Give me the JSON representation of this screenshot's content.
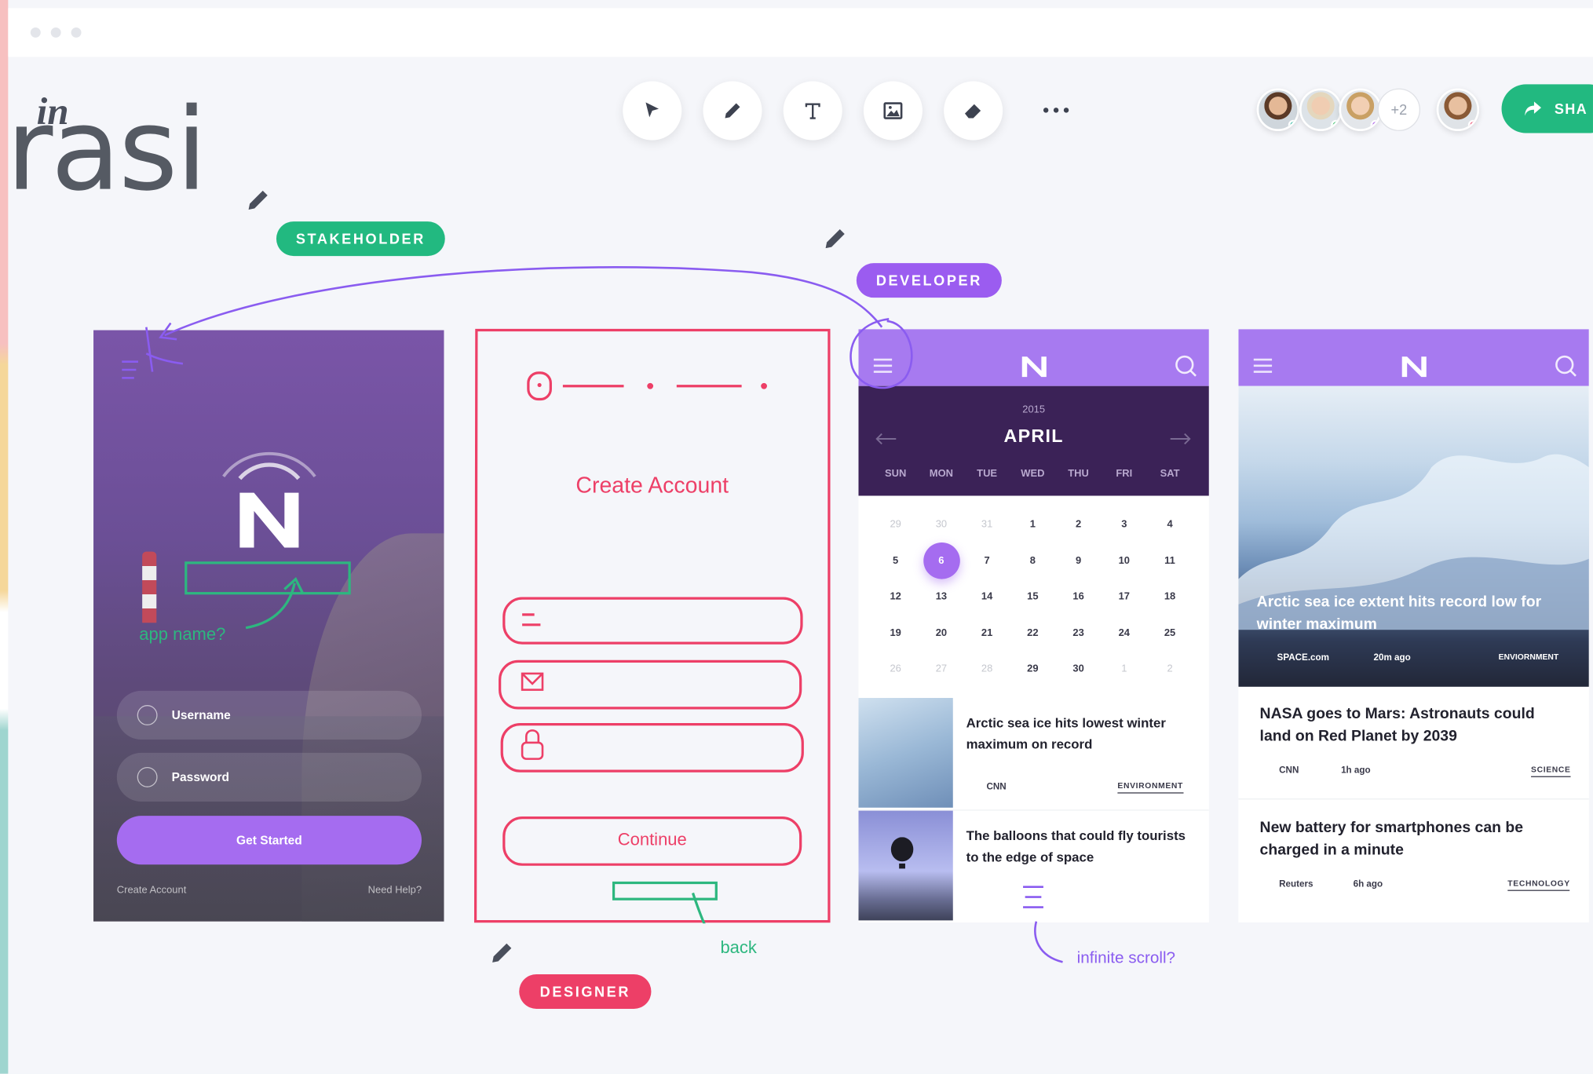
{
  "app": {
    "logo_in": "in",
    "logo_text": "rasi"
  },
  "toolbar": {
    "tools": [
      "pointer-tool",
      "pencil-tool",
      "text-tool",
      "image-tool",
      "eraser-tool",
      "more-tools"
    ],
    "collaborators_more": "+2",
    "share_label": "SHA"
  },
  "roles": {
    "stakeholder": "STAKEHOLDER",
    "developer": "DEVELOPER",
    "designer": "DESIGNER"
  },
  "colors": {
    "accent_purple": "#a56cf0",
    "green": "#22b980",
    "pink": "#ed3f67",
    "role_purple": "#9b5cf0"
  },
  "login": {
    "annotation": "app name?",
    "username": "Username",
    "password": "Password",
    "cta": "Get Started",
    "create_account": "Create Account",
    "need_help": "Need Help?"
  },
  "wireframe": {
    "title": "Create Account",
    "continue": "Continue",
    "annotation_back": "back"
  },
  "calendar": {
    "year": "2015",
    "month": "APRIL",
    "weekdays": [
      "SUN",
      "MON",
      "TUE",
      "WED",
      "THU",
      "FRI",
      "SAT"
    ],
    "weeks": [
      [
        "29",
        "30",
        "31",
        "1",
        "2",
        "3",
        "4"
      ],
      [
        "5",
        "6",
        "7",
        "8",
        "9",
        "10",
        "11"
      ],
      [
        "12",
        "13",
        "14",
        "15",
        "16",
        "17",
        "18"
      ],
      [
        "19",
        "20",
        "21",
        "22",
        "23",
        "24",
        "25"
      ],
      [
        "26",
        "27",
        "28",
        "29",
        "30",
        "1",
        "2"
      ]
    ],
    "selected_day": "6",
    "news": [
      {
        "title": "Arctic sea ice hits lowest winter maximum on record",
        "source": "CNN",
        "category": "ENVIRONMENT"
      },
      {
        "title": "The balloons that could fly tourists to the edge of space"
      }
    ],
    "annotation": "infinite scroll?"
  },
  "news": {
    "hero_title": "Arctic sea ice extent hits record low for winter maximum",
    "hero_source": "SPACE.com",
    "hero_time": "20m ago",
    "hero_category": "ENVIORNMENT",
    "articles": [
      {
        "title": "NASA goes to Mars: Astronauts could land on Red Planet by 2039",
        "source": "CNN",
        "time": "1h ago",
        "category": "SCIENCE"
      },
      {
        "title": "New battery for smartphones can be charged in a minute",
        "source": "Reuters",
        "time": "6h ago",
        "category": "TECHNOLOGY"
      }
    ]
  }
}
